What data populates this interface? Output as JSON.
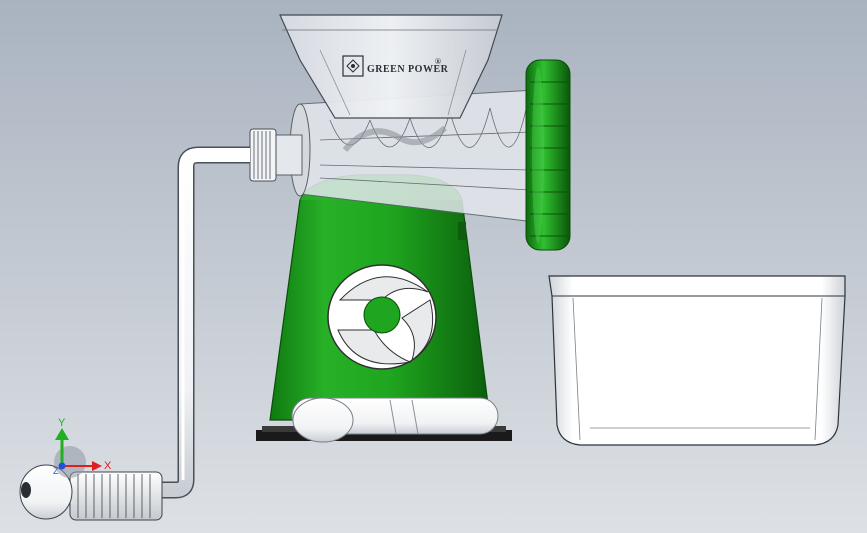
{
  "model": {
    "brand_label": "GREEN POWER",
    "brand_mark": "®",
    "colors": {
      "body": "#1fa51f",
      "body_dark": "#0d6e0d",
      "knob": "#22b522",
      "handle": "#ffffff",
      "hopper": "#e6e9ee",
      "background_top": "#a9b3c0",
      "background_bottom": "#dde1e6"
    }
  },
  "triad": {
    "x_label": "X",
    "y_label": "Y",
    "z_label": "Z",
    "x_color": "#e02020",
    "y_color": "#20b020",
    "z_color": "#2050e0"
  }
}
